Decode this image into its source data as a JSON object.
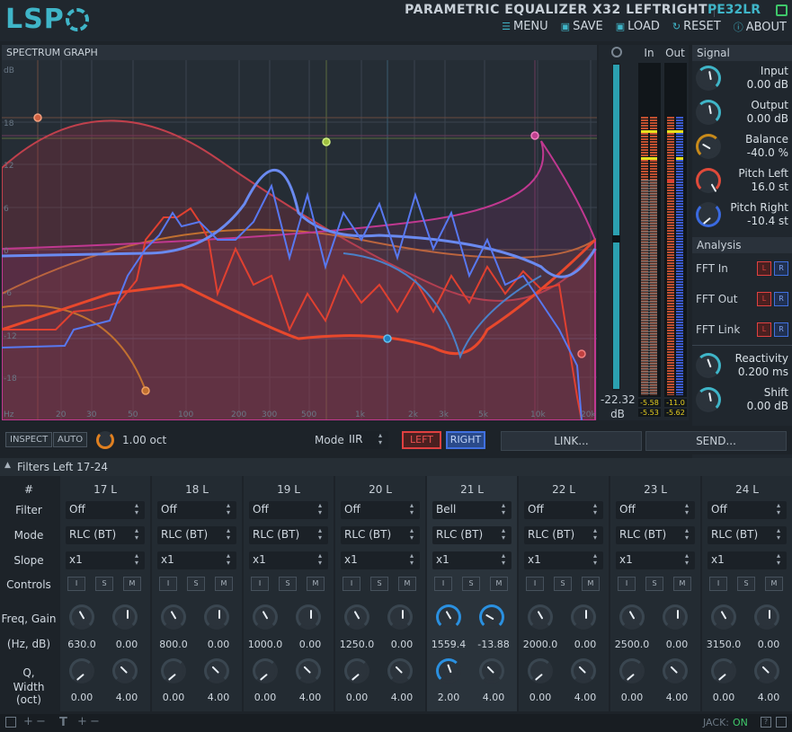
{
  "app": {
    "logo": "LSP",
    "title": "PARAMETRIC EQUALIZER X32 LEFTRIGHT",
    "short_name": "PE32LR"
  },
  "menu": [
    {
      "label": "MENU",
      "icon": "menu-icon"
    },
    {
      "label": "SAVE",
      "icon": "save-icon"
    },
    {
      "label": "LOAD",
      "icon": "load-icon"
    },
    {
      "label": "RESET",
      "icon": "reset-icon"
    },
    {
      "label": "ABOUT",
      "icon": "info-icon"
    }
  ],
  "graph": {
    "title": "SPECTRUM GRAPH",
    "y_ticks": [
      "dB",
      "18",
      "12",
      "6",
      "0",
      "-6",
      "-12",
      "-18"
    ],
    "x_ticks": [
      "Hz",
      "20",
      "30",
      "50",
      "100",
      "200",
      "300",
      "500",
      "1k",
      "2k",
      "3k",
      "5k",
      "10k",
      "20k"
    ]
  },
  "meters": {
    "in_label": "In",
    "out_label": "Out",
    "gain_value": "-22.32",
    "gain_unit": "dB",
    "in_vals": [
      "-5.58",
      "-5.53"
    ],
    "out_vals": [
      "-11.0",
      "-5.62"
    ]
  },
  "signal": {
    "title": "Signal",
    "knobs": [
      {
        "label": "Input",
        "value": "0.00 dB",
        "color": "#3fb5c8",
        "angle": -10
      },
      {
        "label": "Output",
        "value": "0.00 dB",
        "color": "#3fb5c8",
        "angle": -10
      },
      {
        "label": "Balance",
        "value": "-40.0 %",
        "color": "#c88a1a",
        "angle": -60
      },
      {
        "label": "Pitch Left",
        "value": "16.0 st",
        "color": "#e04a3a",
        "angle": 60
      },
      {
        "label": "Pitch Right",
        "value": "-10.4 st",
        "color": "#3a6ae0",
        "angle": -40
      }
    ]
  },
  "analysis": {
    "title": "Analysis",
    "rows": [
      {
        "label": "FFT In",
        "l": "L",
        "r": "R"
      },
      {
        "label": "FFT Out",
        "l": "L",
        "r": "R"
      },
      {
        "label": "FFT Link",
        "l": "L",
        "r": "R"
      }
    ],
    "knobs": [
      {
        "label": "Reactivity",
        "value": "0.200 ms",
        "color": "#3fb5c8",
        "angle": -20
      },
      {
        "label": "Shift",
        "value": "0.00 dB",
        "color": "#3fb5c8",
        "angle": -10
      }
    ]
  },
  "toolbar": {
    "inspect": "INSPECT",
    "auto": "AUTO",
    "oct_value": "1.00 oct",
    "mode_label": "Mode",
    "mode_value": "IIR",
    "left": "LEFT",
    "right": "RIGHT",
    "link": "LINK...",
    "send": "SEND..."
  },
  "filters": {
    "header": "Filters Left 17-24",
    "row_labels": {
      "num": "#",
      "filter": "Filter",
      "mode": "Mode",
      "slope": "Slope",
      "controls": "Controls",
      "freq_gain": "Freq, Gain",
      "freq_gain_units": "(Hz, dB)",
      "q": "Q,",
      "width": "Width (oct)"
    },
    "controls": [
      "I",
      "S",
      "M"
    ],
    "columns": [
      {
        "name": "17 L",
        "filter": "Off",
        "mode": "RLC (BT)",
        "slope": "x1",
        "freq": "630.0",
        "gain": "0.00",
        "q": "0.00",
        "width": "4.00",
        "active": false
      },
      {
        "name": "18 L",
        "filter": "Off",
        "mode": "RLC (BT)",
        "slope": "x1",
        "freq": "800.0",
        "gain": "0.00",
        "q": "0.00",
        "width": "4.00",
        "active": false
      },
      {
        "name": "19 L",
        "filter": "Off",
        "mode": "RLC (BT)",
        "slope": "x1",
        "freq": "1000.0",
        "gain": "0.00",
        "q": "0.00",
        "width": "4.00",
        "active": false
      },
      {
        "name": "20 L",
        "filter": "Off",
        "mode": "RLC (BT)",
        "slope": "x1",
        "freq": "1250.0",
        "gain": "0.00",
        "q": "0.00",
        "width": "4.00",
        "active": false
      },
      {
        "name": "21 L",
        "filter": "Bell",
        "mode": "RLC (BT)",
        "slope": "x1",
        "freq": "1559.4",
        "gain": "-13.88",
        "q": "2.00",
        "width": "4.00",
        "active": true
      },
      {
        "name": "22 L",
        "filter": "Off",
        "mode": "RLC (BT)",
        "slope": "x1",
        "freq": "2000.0",
        "gain": "0.00",
        "q": "0.00",
        "width": "4.00",
        "active": false
      },
      {
        "name": "23 L",
        "filter": "Off",
        "mode": "RLC (BT)",
        "slope": "x1",
        "freq": "2500.0",
        "gain": "0.00",
        "q": "0.00",
        "width": "4.00",
        "active": false
      },
      {
        "name": "24 L",
        "filter": "Off",
        "mode": "RLC (BT)",
        "slope": "x1",
        "freq": "3150.0",
        "gain": "0.00",
        "q": "0.00",
        "width": "4.00",
        "active": false
      }
    ]
  },
  "status": {
    "jack_label": "JACK:",
    "jack_value": "ON"
  }
}
